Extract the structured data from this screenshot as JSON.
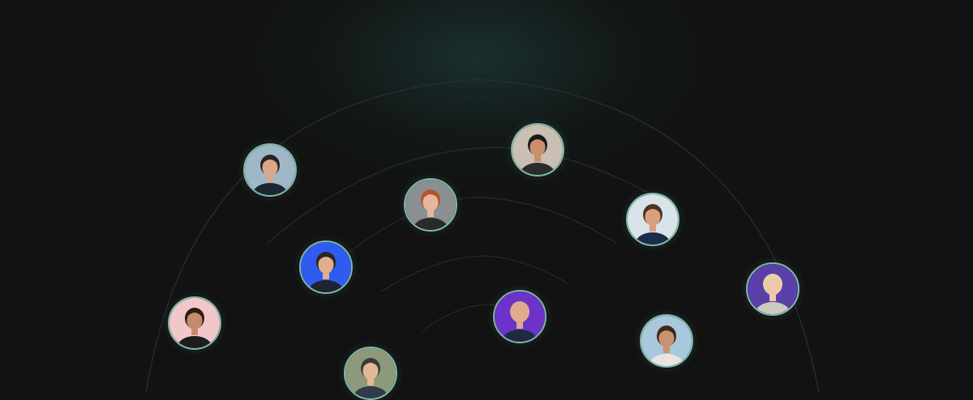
{
  "scene": {
    "background": "#121212",
    "glow_color": "#1f4844",
    "ring_color": "#7fb8a9"
  },
  "avatars": [
    {
      "name": "avatar-man-city-backdrop",
      "bg": "#9fb8c8",
      "skin": "#d8a88a",
      "hair": "#2a2420",
      "shirt": "#1c2633"
    },
    {
      "name": "avatar-woman-hijab",
      "bg": "#c9bfb3",
      "skin": "#c9906b",
      "hair": "#1a1a1a",
      "shirt": "#2b2b2b"
    },
    {
      "name": "avatar-woman-red-hair",
      "bg": "#8a8f92",
      "skin": "#e5b79c",
      "hair": "#b5532e",
      "shirt": "#2a2a2a"
    },
    {
      "name": "avatar-man-selfie",
      "bg": "#d9e3ea",
      "skin": "#d8a07e",
      "hair": "#4b3526",
      "shirt": "#1b2b4a"
    },
    {
      "name": "avatar-man-blue-background",
      "bg": "#2f5bf0",
      "skin": "#e0b08e",
      "hair": "#2b2520",
      "shirt": "#1d2430"
    },
    {
      "name": "avatar-woman-blonde-purple",
      "bg": "#5a3fa8",
      "skin": "#efc7ad",
      "hair": "#e6d3a6",
      "shirt": "#cfc9c4"
    },
    {
      "name": "avatar-woman-pink-background",
      "bg": "#f2c7c9",
      "skin": "#c58c6c",
      "hair": "#2c1c16",
      "shirt": "#1d1d1d"
    },
    {
      "name": "avatar-man-bald-purple",
      "bg": "#6b33c9",
      "skin": "#e0aa8c",
      "hair": "#e0aa8c",
      "shirt": "#1f2a40"
    },
    {
      "name": "avatar-man-beard-beach",
      "bg": "#a9c8dc",
      "skin": "#c9936f",
      "hair": "#3a2a1e",
      "shirt": "#e9e5df"
    },
    {
      "name": "avatar-man-beanie",
      "bg": "#8c9a7a",
      "skin": "#e2b896",
      "hair": "#3c3a38",
      "shirt": "#2f3a4a"
    }
  ]
}
